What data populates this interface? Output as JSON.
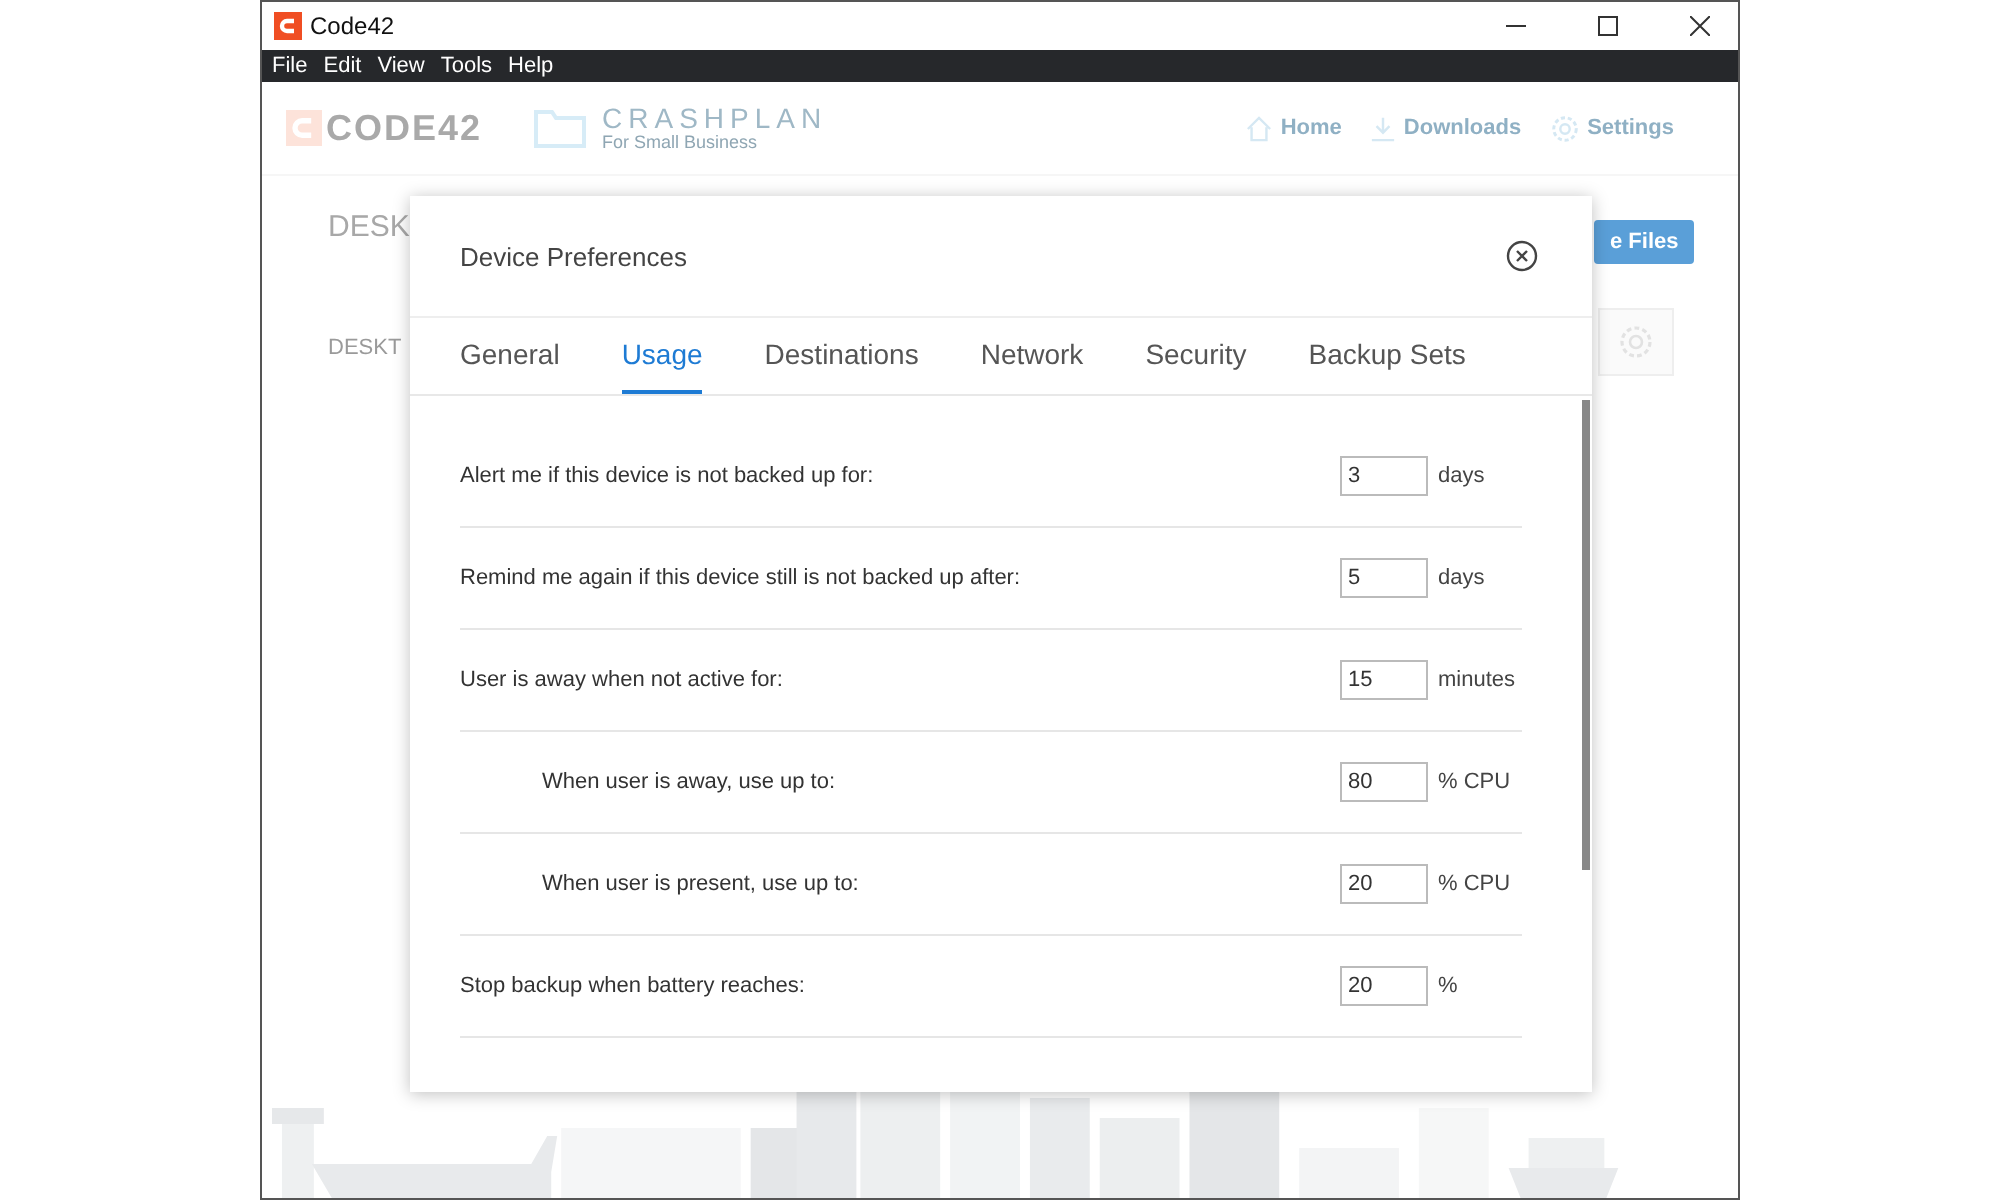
{
  "window": {
    "title": "Code42"
  },
  "menu": [
    "File",
    "Edit",
    "View",
    "Tools",
    "Help"
  ],
  "header": {
    "logo": "CODE42",
    "product": "CRASHPLAN",
    "product_sub": "For Small Business",
    "nav": [
      {
        "label": "Home"
      },
      {
        "label": "Downloads"
      },
      {
        "label": "Settings"
      }
    ]
  },
  "background": {
    "device_title": "DESK",
    "device_tab": "DESKT",
    "button": "e Files"
  },
  "dialog": {
    "title": "Device Preferences",
    "tabs": [
      {
        "label": "General",
        "selected": false
      },
      {
        "label": "Usage",
        "selected": true
      },
      {
        "label": "Destinations",
        "selected": false
      },
      {
        "label": "Network",
        "selected": false
      },
      {
        "label": "Security",
        "selected": false
      },
      {
        "label": "Backup Sets",
        "selected": false
      }
    ],
    "settings": [
      {
        "label": "Alert me if this device is not backed up for:",
        "value": "3",
        "unit": "days"
      },
      {
        "label": "Remind me again if this device still is not backed up after:",
        "value": "5",
        "unit": "days"
      },
      {
        "label": "User is away when not active for:",
        "value": "15",
        "unit": "minutes",
        "children": [
          {
            "label": "When user is away, use up to:",
            "value": "80",
            "unit": "% CPU"
          },
          {
            "label": "When user is present, use up to:",
            "value": "20",
            "unit": "% CPU"
          }
        ]
      },
      {
        "label": "Stop backup when battery reaches:",
        "value": "20",
        "unit": "%"
      }
    ]
  }
}
